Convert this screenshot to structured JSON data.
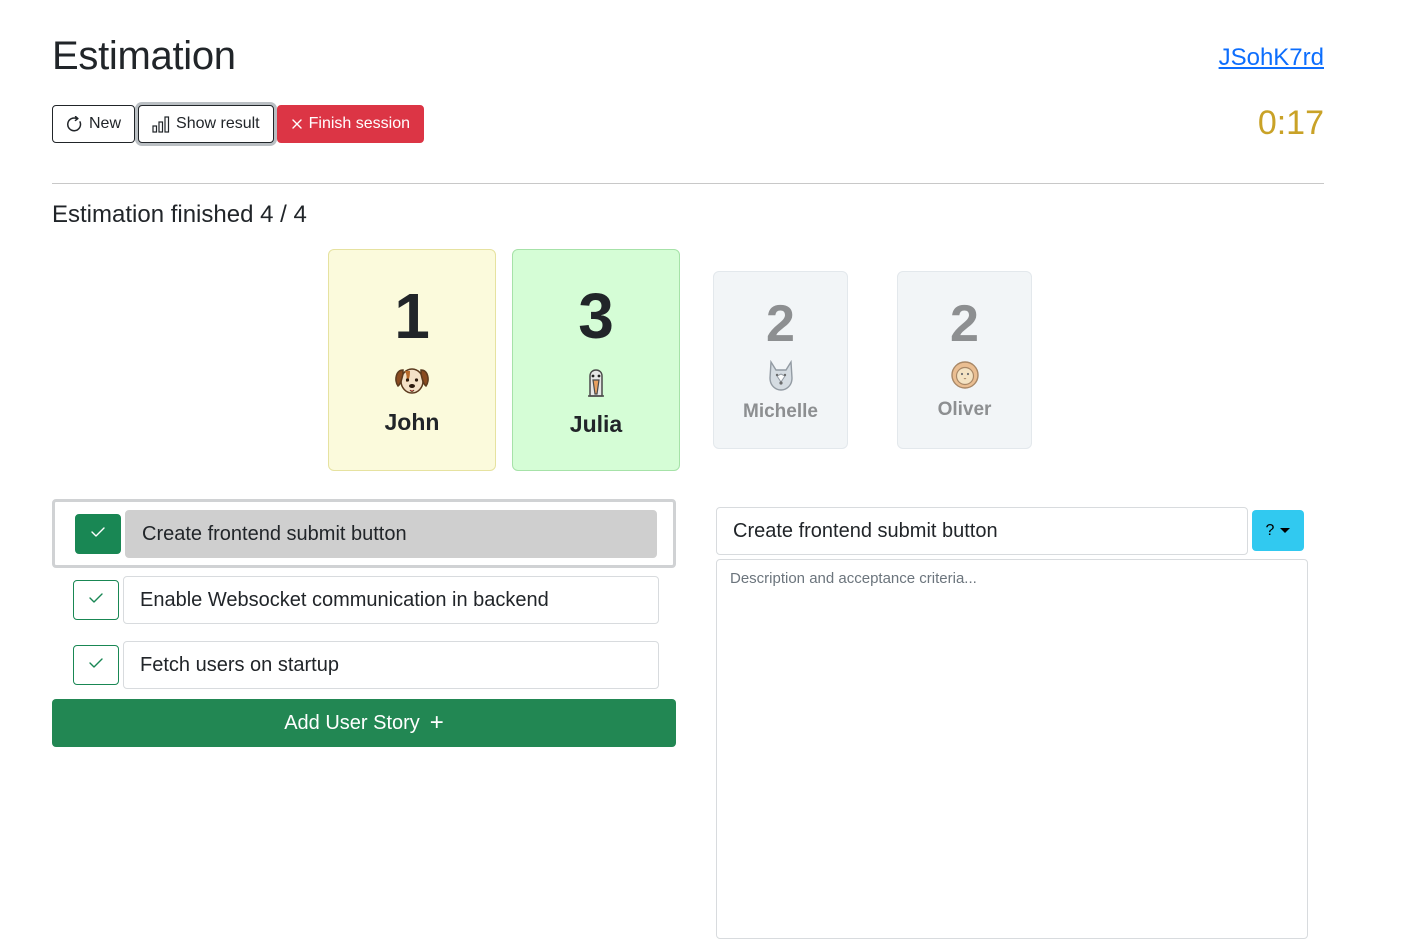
{
  "header": {
    "title": "Estimation",
    "session_id": "JSohK7rd",
    "timer": "0:17"
  },
  "toolbar": {
    "new_label": "New",
    "show_result_label": "Show result",
    "finish_label": "Finish session"
  },
  "status": {
    "text": "Estimation finished 4 / 4"
  },
  "cards": [
    {
      "value": "1",
      "name": "John",
      "avatar": "dog-icon",
      "color": "#fbfadc"
    },
    {
      "value": "3",
      "name": "Julia",
      "avatar": "goose-icon",
      "color": "#d5fdd6"
    },
    {
      "value": "2",
      "name": "Michelle",
      "avatar": "wolf-icon",
      "color": "#f2f5f7"
    },
    {
      "value": "2",
      "name": "Oliver",
      "avatar": "lion-icon",
      "color": "#f2f5f7"
    }
  ],
  "stories": [
    {
      "title": "Create frontend submit button",
      "selected": true
    },
    {
      "title": "Enable Websocket communication in backend",
      "selected": false
    },
    {
      "title": "Fetch users on startup",
      "selected": false
    }
  ],
  "add_story_label": "Add User Story",
  "editor": {
    "title_value": "Create frontend submit button",
    "estimate_value": "?",
    "description_placeholder": "Description and acceptance criteria..."
  },
  "colors": {
    "accent_green": "#228753",
    "danger": "#dc3545",
    "timer": "#c9a227",
    "link": "#0d6efd",
    "dropdown": "#31c9f0"
  }
}
